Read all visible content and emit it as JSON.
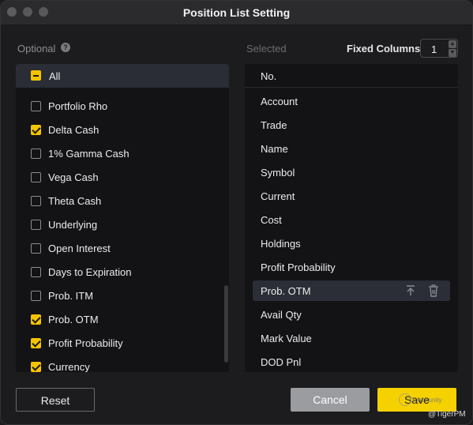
{
  "window": {
    "title": "Position List Setting"
  },
  "header": {
    "optional_label": "Optional",
    "help_icon": "?",
    "selected_label": "Selected",
    "fixed_columns_label": "Fixed Columns",
    "fixed_columns_value": "1"
  },
  "optional": {
    "all_label": "All",
    "all_state": "partial",
    "items": [
      {
        "label": "Portfolio Rho",
        "checked": false
      },
      {
        "label": "Delta Cash",
        "checked": true
      },
      {
        "label": "1% Gamma Cash",
        "checked": false
      },
      {
        "label": "Vega Cash",
        "checked": false
      },
      {
        "label": "Theta Cash",
        "checked": false
      },
      {
        "label": "Underlying",
        "checked": false
      },
      {
        "label": "Open Interest",
        "checked": false
      },
      {
        "label": "Days to Expiration",
        "checked": false
      },
      {
        "label": "Prob. ITM",
        "checked": false
      },
      {
        "label": "Prob. OTM",
        "checked": true
      },
      {
        "label": "Profit Probability",
        "checked": true
      },
      {
        "label": "Currency",
        "checked": true
      }
    ]
  },
  "selected": {
    "header": "No.",
    "items": [
      {
        "label": "Account"
      },
      {
        "label": "Trade"
      },
      {
        "label": "Name"
      },
      {
        "label": "Symbol"
      },
      {
        "label": "Current"
      },
      {
        "label": "Cost"
      },
      {
        "label": "Holdings"
      },
      {
        "label": "Profit Probability"
      },
      {
        "label": "Prob. OTM",
        "highlighted": true,
        "icons": [
          "move-to-top-icon",
          "trash-icon"
        ]
      },
      {
        "label": "Avail Qty"
      },
      {
        "label": "Mark Value"
      },
      {
        "label": "DOD Pnl"
      }
    ]
  },
  "footer": {
    "reset_label": "Reset",
    "cancel_label": "Cancel",
    "save_label": "Save"
  },
  "watermark": {
    "small_text": "Community",
    "handle": "@TigerPM"
  },
  "colors": {
    "accent": "#f5c400",
    "save": "#f5d100",
    "cancel": "#9a9ca0",
    "panel": "#131316",
    "highlight": "#2b2e36"
  }
}
